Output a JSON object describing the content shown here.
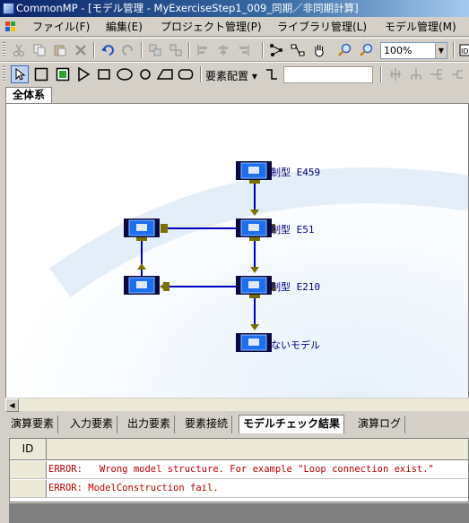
{
  "window": {
    "title": "CommonMP - [モデル管理 - MyExerciseStep1_009_同期／非同期計算]"
  },
  "menu": {
    "items": [
      "ファイル(F)",
      "編集(E)",
      "プロジェクト管理(P)",
      "ライブラリ管理(L)",
      "モデル管理(M)"
    ]
  },
  "toolbar1": {
    "zoom_value": "100%",
    "buttons": [
      "cut-icon",
      "copy-icon",
      "paste-icon",
      "delete-icon",
      "undo-icon",
      "redo-icon",
      "group-icon",
      "ungroup-icon",
      "align-left-icon",
      "align-center-icon",
      "align-right-icon",
      "network-icon",
      "hand-icon",
      "zoom-in-icon",
      "zoom-out-icon"
    ]
  },
  "toolbar2": {
    "layout_label": "要素配置",
    "tools": [
      "pointer-icon",
      "rect-outline-icon",
      "rect-green-icon",
      "triangle-icon",
      "rect-icon",
      "ellipse-icon",
      "circle-icon",
      "parallelogram-icon",
      "rounded-rect-icon"
    ]
  },
  "top_tabs": [
    {
      "label": "全体系",
      "active": true
    }
  ],
  "canvas": {
    "nodes": [
      {
        "id": "E459",
        "label": "制型 E459"
      },
      {
        "id": "E51",
        "label": "制型 E51"
      },
      {
        "id": "E210",
        "label": "制型 E210"
      },
      {
        "id": "bottom",
        "label": "ないモデル"
      }
    ]
  },
  "bottom_tabs": [
    {
      "label": "演算要素",
      "active": false
    },
    {
      "label": "入力要素",
      "active": false
    },
    {
      "label": "出力要素",
      "active": false
    },
    {
      "label": "要素接続",
      "active": false
    },
    {
      "label": "モデルチェック結果",
      "active": true
    },
    {
      "label": "演算ログ",
      "active": false
    }
  ],
  "results": {
    "columns": {
      "id": "ID"
    },
    "rows": [
      {
        "message": "ERROR:   Wrong model structure. For example \"Loop connection exist.\""
      },
      {
        "message": "ERROR: ModelConstruction fail."
      }
    ]
  },
  "colors": {
    "title_start": "#0a246a",
    "node_blue": "#1e6ff0",
    "node_dark": "#0a0a40",
    "connector": "#0000c0",
    "error_text": "#c00000"
  }
}
